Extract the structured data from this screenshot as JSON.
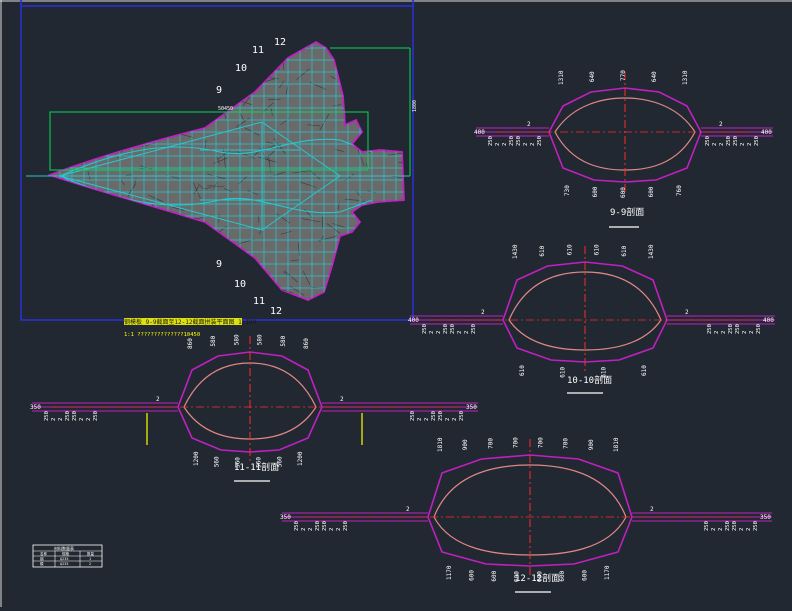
{
  "colors": {
    "background": "#222831",
    "frame": "#2a2fd0",
    "outline": "#c020c0",
    "inner": "#e08888",
    "axis": "#ff2a2a",
    "dim": "#00dd55",
    "yellow": "#ffff00",
    "mesh_fill": "#6a6a6a",
    "mesh_line": "#26c8cf",
    "mesh_dark": "#3a3a3a",
    "label": "#ffffff"
  },
  "plan": {
    "upper_marks": [
      "12",
      "11",
      "10",
      "9"
    ],
    "lower_marks": [
      "9",
      "10",
      "11",
      "12"
    ],
    "dim_right": "1800",
    "dim_top": "50450",
    "caption_main": "钢模板 9-9截面至12-12截面拼装平面图 1:100",
    "caption_sub": "1:1 ??????????????10450"
  },
  "sections": [
    {
      "title": "9-9剖面",
      "top_dims": [
        "1310",
        "640",
        "770",
        "640",
        "1310"
      ],
      "bottom_dims": [
        "730",
        "600",
        "600",
        "600",
        "760"
      ],
      "left_end": "400",
      "right_end": "400",
      "left_vert": [
        "250",
        "2",
        "2",
        "250",
        "250",
        "2",
        "2",
        "250"
      ],
      "right_vert": [
        "250",
        "2",
        "2",
        "250",
        "250",
        "2",
        "2",
        "250"
      ],
      "shoulder_left": "2",
      "shoulder_right": "2"
    },
    {
      "title": "10-10剖面",
      "top_dims": [
        "1430",
        "610",
        "610",
        "610",
        "610",
        "1430"
      ],
      "bottom_dims": [
        "610",
        "610",
        "610",
        "610"
      ],
      "left_end": "400",
      "right_end": "400",
      "left_vert": [
        "250",
        "2",
        "2",
        "250",
        "250",
        "2",
        "2",
        "250"
      ],
      "right_vert": [
        "250",
        "2",
        "2",
        "250",
        "250",
        "2",
        "2",
        "250"
      ],
      "shoulder_left": "2",
      "shoulder_right": "2"
    },
    {
      "title": "11-11剖面",
      "top_dims": [
        "860",
        "580",
        "580",
        "580",
        "580",
        "860"
      ],
      "bottom_dims": [
        "1200",
        "560",
        "560",
        "560",
        "560",
        "1200"
      ],
      "left_end": "350",
      "right_end": "350",
      "left_vert": [
        "250",
        "2",
        "2",
        "250",
        "250",
        "2",
        "2",
        "250"
      ],
      "right_vert": [
        "250",
        "2",
        "2",
        "250",
        "250",
        "2",
        "2",
        "250"
      ],
      "shoulder_left": "2",
      "shoulder_right": "2"
    },
    {
      "title": "12-12剖面",
      "top_dims": [
        "1810",
        "900",
        "700",
        "700",
        "700",
        "700",
        "900",
        "1810"
      ],
      "bottom_dims": [
        "1170",
        "600",
        "600",
        "600",
        "600",
        "600",
        "600",
        "1170"
      ],
      "left_end": "350",
      "right_end": "350",
      "left_vert": [
        "250",
        "2",
        "2",
        "250",
        "250",
        "2",
        "2",
        "250"
      ],
      "right_vert": [
        "250",
        "2",
        "2",
        "250",
        "250",
        "2",
        "2",
        "250"
      ],
      "shoulder_left": "2",
      "shoulder_right": "2"
    }
  ],
  "legend": {
    "title": "材料数量表",
    "headers": [
      "名称",
      "规格",
      "数量"
    ],
    "rows": [
      [
        "钢",
        "Q235",
        "1"
      ],
      [
        "模",
        "Q235",
        "2"
      ]
    ]
  }
}
